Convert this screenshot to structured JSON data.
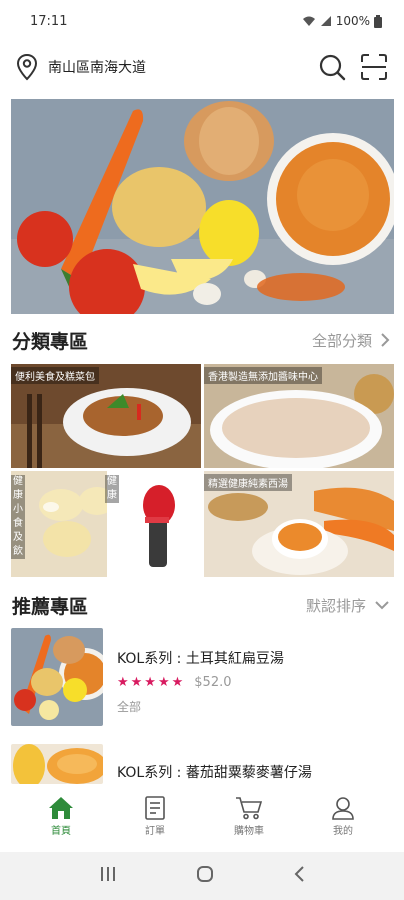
{
  "status_bar": {
    "time": "17:11",
    "battery": "100%"
  },
  "header": {
    "location": "南山區南海大道"
  },
  "categories_section": {
    "title": "分類專區",
    "link_label": "全部分類"
  },
  "categories": [
    {
      "label": "便利美食及糕菜包"
    },
    {
      "label": "香港製造無添加醬味中心"
    },
    {
      "label": "健康小食及飲"
    },
    {
      "label": "精選健康純素西湯"
    }
  ],
  "category_vertical": {
    "tile3_text": "健康小食及飲",
    "tile3_extra": "健康"
  },
  "recommend_section": {
    "title": "推薦專區",
    "sort_label": "默認排序"
  },
  "products": [
    {
      "name": "KOL系列 : 土耳其紅扁豆湯",
      "stars": "★★★★★",
      "price": "$52.0",
      "tag": "全部"
    },
    {
      "name": "KOL系列 : 蕃茄甜粟藜麥薯仔湯"
    }
  ],
  "bottom_nav": [
    {
      "label": "首頁",
      "icon": "home-icon",
      "active": true
    },
    {
      "label": "訂單",
      "icon": "order-icon",
      "active": false
    },
    {
      "label": "購物車",
      "icon": "cart-icon",
      "active": false
    },
    {
      "label": "我的",
      "icon": "profile-icon",
      "active": false
    }
  ],
  "colors": {
    "accent": "#2e8b3a",
    "star": "#d81b60",
    "muted": "#999999"
  }
}
